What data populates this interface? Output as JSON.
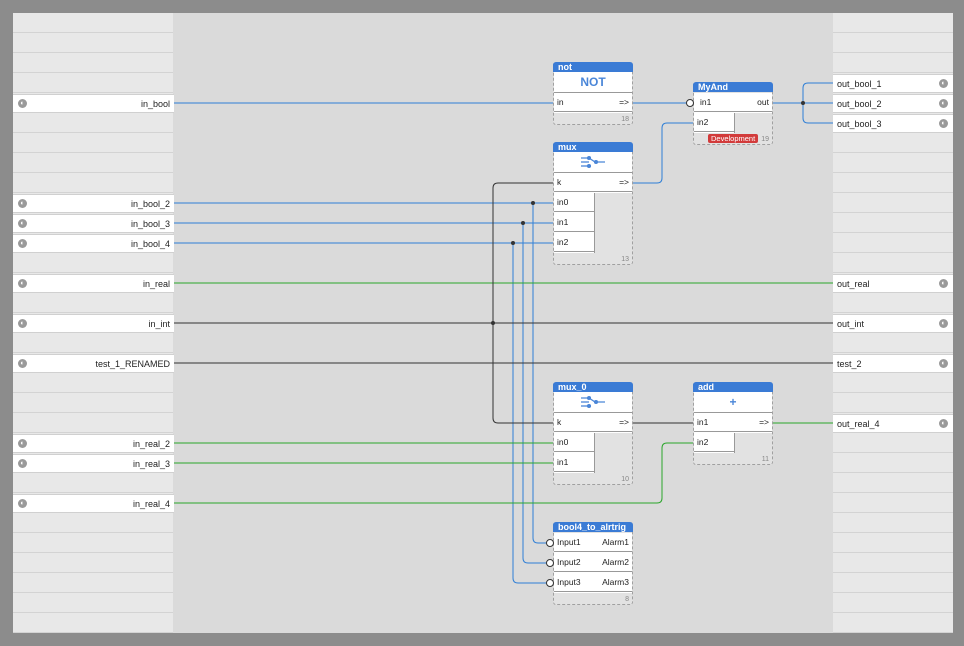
{
  "colors": {
    "bool_wire": "#2f7fd6",
    "real_wire": "#2aa52a",
    "int_wire": "#333333",
    "header": "#3a7bd5",
    "badge": "#d23b3b"
  },
  "left_ports": [
    {
      "label": "in_bool",
      "icon": "pin-icon"
    },
    {
      "label": "in_bool_2",
      "icon": "pin-icon"
    },
    {
      "label": "in_bool_3",
      "icon": "pin-icon"
    },
    {
      "label": "in_bool_4",
      "icon": "pin-icon"
    },
    {
      "label": "in_real",
      "icon": "pin-icon"
    },
    {
      "label": "in_int",
      "icon": "pin-icon"
    },
    {
      "label": "test_1_RENAMED",
      "icon": "pin-icon"
    },
    {
      "label": "in_real_2",
      "icon": "pin-icon"
    },
    {
      "label": "in_real_3",
      "icon": "pin-icon"
    },
    {
      "label": "in_real_4",
      "icon": "pin-icon"
    }
  ],
  "right_ports": [
    {
      "label": "out_bool_1",
      "icon": "pin-icon"
    },
    {
      "label": "out_bool_2",
      "icon": "pin-icon"
    },
    {
      "label": "out_bool_3",
      "icon": "pin-icon"
    },
    {
      "label": "out_real",
      "icon": "pin-icon"
    },
    {
      "label": "out_int",
      "icon": "pin-icon"
    },
    {
      "label": "test_2",
      "icon": "pin-icon"
    },
    {
      "label": "out_real_4",
      "icon": "pin-icon"
    }
  ],
  "blocks": {
    "not": {
      "title": "not",
      "symbol": "NOT",
      "inputs": [
        "in"
      ],
      "outputs": [
        "=>"
      ],
      "id": "18"
    },
    "mux": {
      "title": "mux",
      "symbol": "switch-icon",
      "inputs": [
        "k",
        "in0",
        "in1",
        "in2"
      ],
      "outputs": [
        "=>"
      ],
      "id": "13"
    },
    "myand": {
      "title": "MyAnd",
      "inputs": [
        "in1",
        "in2"
      ],
      "outputs": [
        "out"
      ],
      "badge": "Development",
      "id": "19"
    },
    "mux_0": {
      "title": "mux_0",
      "symbol": "switch-icon",
      "inputs": [
        "k",
        "in0",
        "in1"
      ],
      "outputs": [
        "=>"
      ],
      "id": "10"
    },
    "add": {
      "title": "add",
      "symbol": "+",
      "inputs": [
        "in1",
        "in2"
      ],
      "outputs": [
        "=>"
      ],
      "id": "11"
    },
    "bool4": {
      "title": "bool4_to_alrtrig",
      "inputs": [
        "Input1",
        "Input2",
        "Input3"
      ],
      "outputs": [
        "Alarm1",
        "Alarm2",
        "Alarm3"
      ],
      "id": "8"
    }
  }
}
